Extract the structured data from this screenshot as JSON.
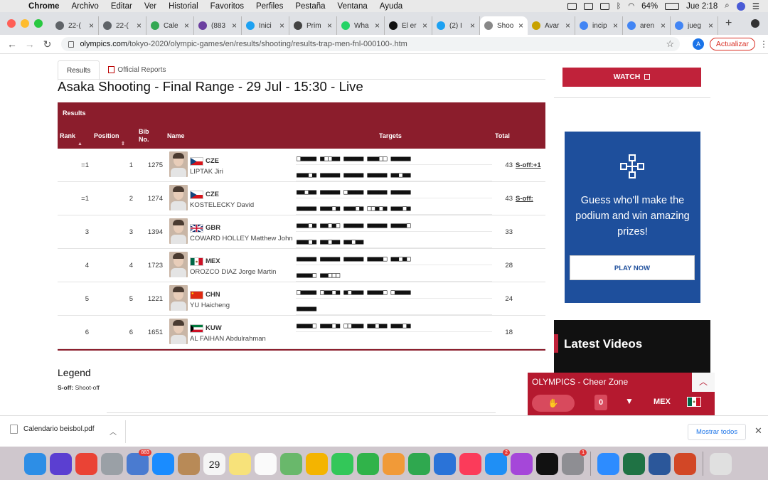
{
  "menubar": {
    "app": "Chrome",
    "items": [
      "Archivo",
      "Editar",
      "Ver",
      "Historial",
      "Favoritos",
      "Perfiles",
      "Pestaña",
      "Ventana",
      "Ayuda"
    ],
    "battery": "64%",
    "clock": "Jue 2:18"
  },
  "tabs": [
    {
      "title": "22-(",
      "icon": "globe-icon",
      "color": "#5f6368"
    },
    {
      "title": "22-(",
      "icon": "globe-icon",
      "color": "#5f6368"
    },
    {
      "title": "Cale",
      "icon": "drive-icon",
      "color": "#34a853"
    },
    {
      "title": "(883",
      "icon": "mail-icon",
      "color": "#6b3fa0"
    },
    {
      "title": "Inici",
      "icon": "twitter-icon",
      "color": "#1da1f2"
    },
    {
      "title": "Prim",
      "icon": "page-icon",
      "color": "#444444"
    },
    {
      "title": "Wha",
      "icon": "whatsapp-icon",
      "color": "#25d366"
    },
    {
      "title": "Él er",
      "icon": "tiktok-icon",
      "color": "#111111"
    },
    {
      "title": "(2) I",
      "icon": "twitter-icon",
      "color": "#1da1f2"
    },
    {
      "title": "Shoo",
      "icon": "olympics-icon",
      "color": "#888888"
    },
    {
      "title": "Avar",
      "icon": "y-icon",
      "color": "#c8a200"
    },
    {
      "title": "incip",
      "icon": "google-icon",
      "color": "#4285f4"
    },
    {
      "title": "aren",
      "icon": "google-icon",
      "color": "#4285f4"
    },
    {
      "title": "jueg",
      "icon": "google-icon",
      "color": "#4285f4"
    }
  ],
  "active_tab": 9,
  "address": {
    "host": "olympics.com",
    "path": "/tokyo-2020/olympic-games/en/results/shooting/results-trap-men-fnl-000100-.htm",
    "profile_initial": "A",
    "update_label": "Actualizar"
  },
  "page": {
    "subtabs": [
      "Results",
      "Official Reports"
    ],
    "title": "Asaka Shooting - Final Range - 29 Jul - 15:30 - Live",
    "results_label": "Results",
    "headers": {
      "rank": "Rank",
      "position": "Position",
      "bib": "Bib No.",
      "name": "Name",
      "targets": "Targets",
      "total": "Total"
    },
    "rows": [
      {
        "rank": "=1",
        "position": "1",
        "bib": "1275",
        "noc": "CZE",
        "name": "LIPTAK Jiri",
        "flag": "cze",
        "targets": [
          "□■■■■ ■□□■■ ■■■■■ ■■■□□ ■■■■■",
          "■■■□■ ■■■■■ ■■■■■ ■■■■■ ■■□■■"
        ],
        "total": "43",
        "soff": "S-off:+1"
      },
      {
        "rank": "=1",
        "position": "2",
        "bib": "1274",
        "noc": "CZE",
        "name": "KOSTELECKY David",
        "flag": "cze",
        "targets": [
          "■■□■■ ■■■■■ □■■■■ ■■■■■ ■■■■■",
          "■■■■■ ■■■□■ ■■■□■ □□■□■ ■■■□■"
        ],
        "total": "43",
        "soff": "S-off:"
      },
      {
        "rank": "3",
        "position": "3",
        "bib": "1394",
        "noc": "GBR",
        "name": "COWARD HOLLEY Matthew John",
        "flag": "gbr",
        "targets": [
          "■■■□■ ■■□■□ ■■■■■ ■■■■■ ■■■■□",
          "■■■□■ ■■□■■ ■■□■■"
        ],
        "total": "33",
        "soff": ""
      },
      {
        "rank": "4",
        "position": "4",
        "bib": "1723",
        "noc": "MEX",
        "name": "OROZCO DIAZ Jorge Martin",
        "flag": "mex",
        "targets": [
          "■■■■■ ■■■■■ ■■■■■ ■■■■□ ■■□■□",
          "■■■■□ ■■□□□"
        ],
        "total": "28",
        "soff": ""
      },
      {
        "rank": "5",
        "position": "5",
        "bib": "1221",
        "noc": "CHN",
        "name": "YU Haicheng",
        "flag": "chn",
        "targets": [
          "□■■■■ □■■□■ ■□■■■ ■■■■□ □■■■■",
          "■■■■■"
        ],
        "total": "24",
        "soff": ""
      },
      {
        "rank": "6",
        "position": "6",
        "bib": "1651",
        "noc": "KUW",
        "name": "AL FAIHAN Abdulrahman",
        "flag": "kuw",
        "targets": [
          "■■■■□ ■■■□■ □□■■■ ■■□■■ ■■■□■"
        ],
        "total": "18",
        "soff": ""
      }
    ],
    "legend_title": "Legend",
    "legend_key": "S-off:",
    "legend_text": "Shoot-off"
  },
  "sidebar": {
    "watch_label": "WATCH",
    "ad_text": "Guess who'll make the podium and win amazing prizes!",
    "ad_button": "PLAY NOW",
    "videos_title": "Latest Videos"
  },
  "cheer": {
    "title": "OLYMPICS - Cheer Zone",
    "count": "0",
    "country": "MEX"
  },
  "download": {
    "file": "Calendario beisbol.pdf",
    "show_all": "Mostrar todos"
  },
  "dock": [
    {
      "name": "finder-icon",
      "color": "#2d8ee6"
    },
    {
      "name": "siri-icon",
      "color": "#5b3fd1"
    },
    {
      "name": "chrome-icon",
      "color": "#ea4335"
    },
    {
      "name": "launchpad-icon",
      "color": "#9aa0a6"
    },
    {
      "name": "mail-stamp-icon",
      "color": "#4a7bd0",
      "badge": "883"
    },
    {
      "name": "safari-icon",
      "color": "#1a8cff"
    },
    {
      "name": "contacts-icon",
      "color": "#b88a57"
    },
    {
      "name": "calendar-icon",
      "color": "#f5f5f5",
      "label": "29"
    },
    {
      "name": "notes-icon",
      "color": "#f7e27a"
    },
    {
      "name": "reminders-icon",
      "color": "#fafafa"
    },
    {
      "name": "maps-icon",
      "color": "#69b86b"
    },
    {
      "name": "photos-icon",
      "color": "#f4b400"
    },
    {
      "name": "messages-icon",
      "color": "#33c759"
    },
    {
      "name": "facetime-icon",
      "color": "#30b34a"
    },
    {
      "name": "pages-icon",
      "color": "#f19a38"
    },
    {
      "name": "numbers-icon",
      "color": "#2fa84f"
    },
    {
      "name": "keynote-icon",
      "color": "#2a73d8"
    },
    {
      "name": "music-icon",
      "color": "#fb3b5a"
    },
    {
      "name": "appstore-icon",
      "color": "#1f8ff5",
      "badge": "2"
    },
    {
      "name": "podcasts-icon",
      "color": "#a547d9"
    },
    {
      "name": "tv-icon",
      "color": "#111111"
    },
    {
      "name": "settings-icon",
      "color": "#8e8e93",
      "badge": "1"
    },
    {
      "name": "zoom-icon",
      "color": "#2d8cff"
    },
    {
      "name": "excel-icon",
      "color": "#1f7244"
    },
    {
      "name": "word-icon",
      "color": "#2b579a"
    },
    {
      "name": "powerpoint-icon",
      "color": "#d24726"
    },
    {
      "name": "trash-icon",
      "color": "#e0e0e0"
    }
  ]
}
